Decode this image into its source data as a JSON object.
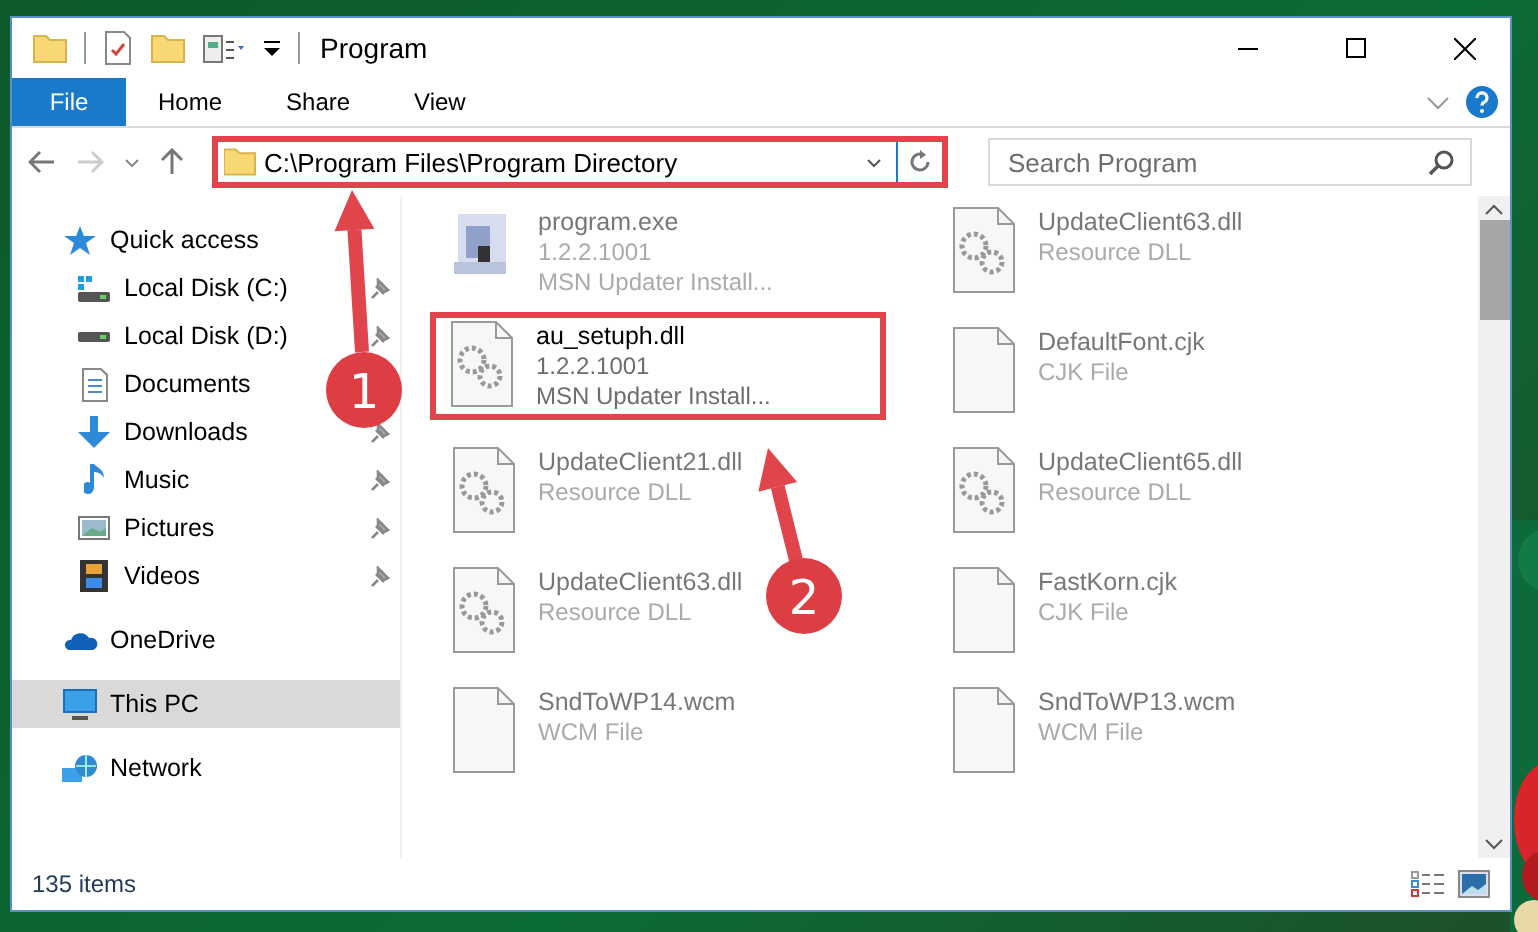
{
  "window": {
    "title": "Program"
  },
  "ribbon": {
    "tabs": [
      {
        "label": "File",
        "kind": "menu"
      },
      {
        "label": "Home",
        "kind": "tab"
      },
      {
        "label": "Share",
        "kind": "tab"
      },
      {
        "label": "View",
        "kind": "tab"
      }
    ]
  },
  "address_bar": {
    "path": "C:\\Program Files\\Program Directory",
    "highlighted": true
  },
  "search": {
    "placeholder": "Search Program"
  },
  "sidebar": {
    "items": [
      {
        "label": "Quick access",
        "selected": false,
        "children": [
          {
            "label": "Local Disk (C:)",
            "pinned": true,
            "selected": false
          },
          {
            "label": "Local Disk (D:)",
            "pinned": true,
            "selected": false
          },
          {
            "label": "Documents",
            "selected": false
          },
          {
            "label": "Downloads",
            "pinned": true,
            "selected": false
          },
          {
            "label": "Music",
            "pinned": true,
            "selected": false
          },
          {
            "label": "Pictures",
            "pinned": true,
            "selected": false
          },
          {
            "label": "Videos",
            "pinned": true,
            "selected": false
          }
        ]
      },
      {
        "label": "OneDrive",
        "selected": false
      },
      {
        "label": "This PC",
        "selected": true
      },
      {
        "label": "Network",
        "selected": false
      }
    ]
  },
  "files": [
    {
      "name": "program.exe",
      "details": [
        "1.2.2.1001",
        "MSN Updater Install..."
      ],
      "kind": "exe",
      "highlighted": false
    },
    {
      "name": "UpdateClient63.dll",
      "details": [
        "Resource DLL"
      ],
      "kind": "dll",
      "highlighted": false
    },
    {
      "name": "au_setuph.dll",
      "details": [
        "1.2.2.1001",
        "MSN Updater Install..."
      ],
      "kind": "dll",
      "highlighted": true
    },
    {
      "name": "DefaultFont.cjk",
      "details": [
        "CJK File"
      ],
      "kind": "blank",
      "highlighted": false
    },
    {
      "name": "UpdateClient21.dll",
      "details": [
        "Resource DLL"
      ],
      "kind": "dll",
      "highlighted": false
    },
    {
      "name": "UpdateClient65.dll",
      "details": [
        "Resource DLL"
      ],
      "kind": "dll",
      "highlighted": false
    },
    {
      "name": "UpdateClient63.dll",
      "details": [
        "Resource DLL"
      ],
      "kind": "dll",
      "highlighted": false
    },
    {
      "name": "FastKorn.cjk",
      "details": [
        "CJK File"
      ],
      "kind": "blank",
      "highlighted": false
    },
    {
      "name": "SndToWP14.wcm",
      "details": [
        "WCM File"
      ],
      "kind": "blank",
      "highlighted": false
    },
    {
      "name": "SndToWP13.wcm",
      "details": [
        "WCM File"
      ],
      "kind": "blank",
      "highlighted": false
    }
  ],
  "callouts": [
    {
      "label": "1"
    },
    {
      "label": "2"
    }
  ],
  "status_bar": {
    "item_count": "135 items"
  }
}
